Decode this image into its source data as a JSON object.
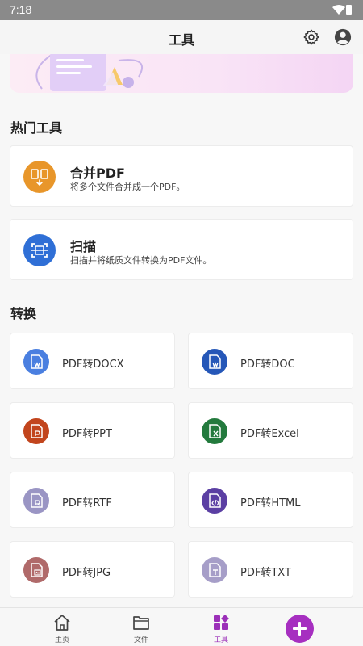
{
  "status_bar": {
    "time": "7:18",
    "icons": [
      "wifi-icon",
      "battery-icon"
    ]
  },
  "app_bar": {
    "title": "工具",
    "icons": [
      "gear-icon",
      "account-icon"
    ]
  },
  "sections": {
    "hot_tools": {
      "title": "热门工具"
    },
    "convert": {
      "title": "转换"
    }
  },
  "hot_tools": [
    {
      "name": "合并PDF",
      "desc": "将多个文件合并成一个PDF。",
      "color": "#e8962a",
      "icon": "merge-pdf-icon"
    },
    {
      "name": "扫描",
      "desc": "扫描并将纸质文件转换为PDF文件。",
      "color": "#2f6fd6",
      "icon": "scan-icon"
    }
  ],
  "convert_tools": [
    {
      "name": "PDF转DOCX",
      "color": "#4a7fe0",
      "icon": "pdf-to-docx-icon"
    },
    {
      "name": "PDF转DOC",
      "color": "#2557b8",
      "icon": "pdf-to-doc-icon"
    },
    {
      "name": "PDF转PPT",
      "color": "#c2451d",
      "icon": "pdf-to-ppt-icon"
    },
    {
      "name": "PDF转Excel",
      "color": "#237a3d",
      "icon": "pdf-to-excel-icon"
    },
    {
      "name": "PDF转RTF",
      "color": "#9a95c4",
      "icon": "pdf-to-rtf-icon"
    },
    {
      "name": "PDF转HTML",
      "color": "#5b3fa3",
      "icon": "pdf-to-html-icon"
    },
    {
      "name": "PDF转JPG",
      "color": "#b06a6a",
      "icon": "pdf-to-jpg-icon"
    },
    {
      "name": "PDF转TXT",
      "color": "#a69ec8",
      "icon": "pdf-to-txt-icon"
    }
  ],
  "bottom_nav": [
    {
      "label": "主页",
      "icon": "home-icon",
      "active": false
    },
    {
      "label": "文件",
      "icon": "folder-icon",
      "active": false
    },
    {
      "label": "工具",
      "icon": "tools-icon",
      "active": true
    }
  ],
  "fab": {
    "icon": "plus-icon",
    "color": "#a62fc0"
  }
}
